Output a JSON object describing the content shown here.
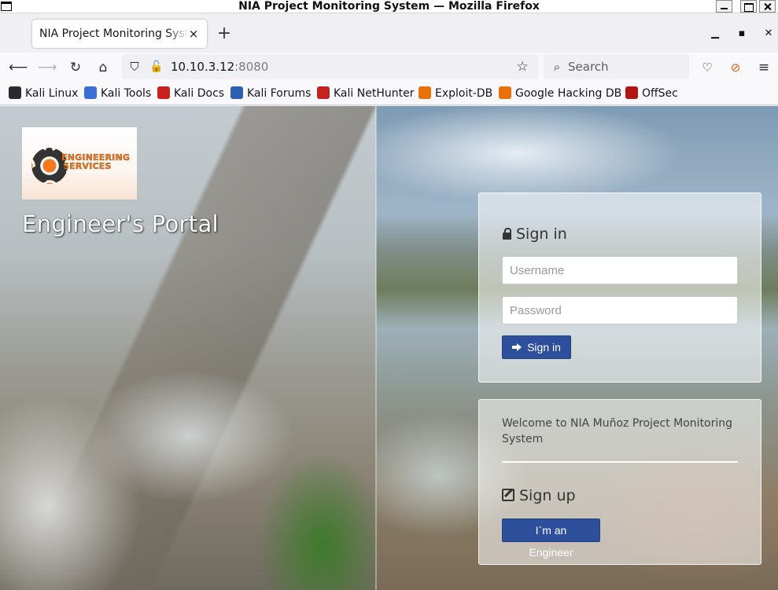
{
  "window": {
    "title": "NIA Project Monitoring System — Mozilla Firefox"
  },
  "tab": {
    "title": "NIA Project Monitoring System",
    "close": "×"
  },
  "toolbar": {
    "new_tab": "+",
    "url_host": "10.10.3.12",
    "url_port": ":8080",
    "search_placeholder": "Search"
  },
  "bookmarks": [
    {
      "label": "Kali Linux",
      "color": "#2b2b2b"
    },
    {
      "label": "Kali Tools",
      "color": "#3b6fd4"
    },
    {
      "label": "Kali Docs",
      "color": "#c5221f"
    },
    {
      "label": "Kali Forums",
      "color": "#2f5fb3"
    },
    {
      "label": "Kali NetHunter",
      "color": "#c5221f"
    },
    {
      "label": "Exploit-DB",
      "color": "#e8710a"
    },
    {
      "label": "Google Hacking DB",
      "color": "#e8710a"
    },
    {
      "label": "OffSec",
      "color": "#b31412"
    }
  ],
  "page": {
    "logo_line1": "ENGINEERING",
    "logo_line2": "SERVICES",
    "portal_title": "Engineer's Portal",
    "signin": {
      "heading": "Sign in",
      "username_placeholder": "Username",
      "password_placeholder": "Password",
      "button": "Sign in"
    },
    "signup": {
      "welcome": "Welcome to NIA Muñoz Project Monitoring System",
      "heading": "Sign up",
      "button": "I`m an Engineer"
    }
  }
}
